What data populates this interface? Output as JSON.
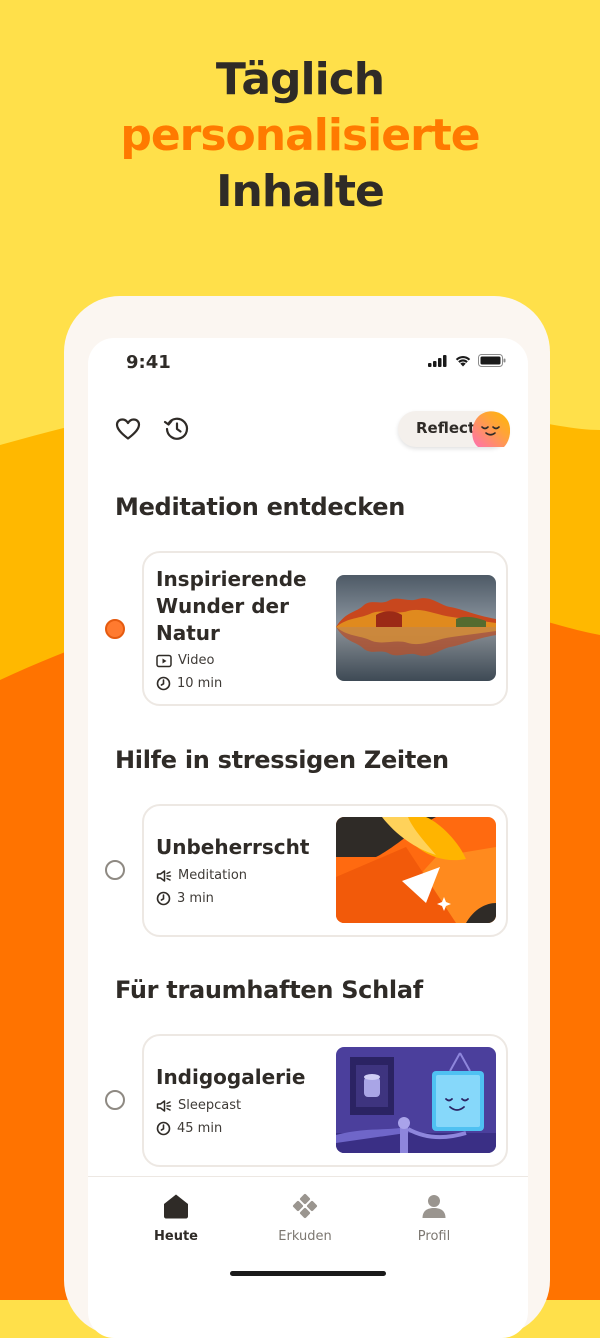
{
  "headline": {
    "line1": "Täglich",
    "line2": "personalisierte",
    "line3": "Inhalte"
  },
  "colors": {
    "background_top": "#FFE04A",
    "background_mid": "#FFB800",
    "background_bottom": "#FF7300",
    "accent": "#FF7A00",
    "text_dark": "#2F2B27"
  },
  "status_bar": {
    "time": "9:41",
    "icons": [
      "signal-icon",
      "wifi-icon",
      "battery-icon"
    ]
  },
  "top_bar": {
    "favorite_icon": "heart-icon",
    "history_icon": "history-icon",
    "reflect_label": "Reflect"
  },
  "sections": [
    {
      "title": "Meditation entdecken",
      "card": {
        "title": "Inspirierende Wunder der Natur",
        "type": "Video",
        "duration": "10 min",
        "selected": true
      }
    },
    {
      "title": "Hilfe in stressigen Zeiten",
      "card": {
        "title": "Unbeherrscht",
        "type": "Meditation",
        "duration": "3 min",
        "selected": false
      }
    },
    {
      "title": "Für traumhaften Schlaf",
      "card": {
        "title": "Indigogalerie",
        "type": "Sleepcast",
        "duration": "45 min",
        "selected": false
      }
    }
  ],
  "tabs": [
    {
      "label": "Heute",
      "icon": "home-icon",
      "active": true
    },
    {
      "label": "Erkuden",
      "icon": "explore-icon",
      "active": false
    },
    {
      "label": "Profil",
      "icon": "profile-icon",
      "active": false
    }
  ]
}
